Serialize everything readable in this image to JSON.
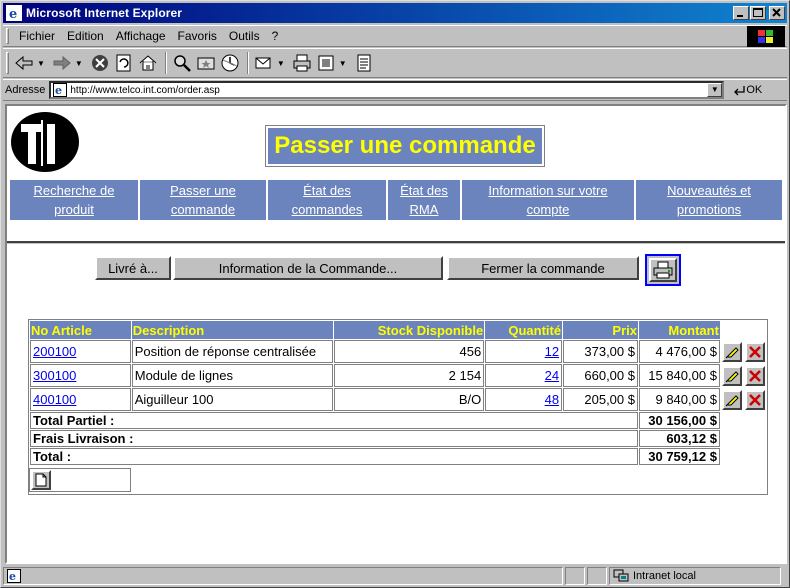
{
  "window": {
    "title": "Microsoft Internet Explorer"
  },
  "menu": [
    {
      "label": "Fichier"
    },
    {
      "label": "Edition"
    },
    {
      "label": "Affichage"
    },
    {
      "label": "Favoris"
    },
    {
      "label": "Outils"
    },
    {
      "label": "?"
    }
  ],
  "toolbar": {
    "icons": [
      "back-arrow-icon",
      "forward-arrow-icon",
      "stop-icon",
      "refresh-icon",
      "home-icon",
      "search-icon",
      "favorites-icon",
      "history-icon",
      "mail-icon",
      "print-icon",
      "edit-icon",
      "discuss-icon"
    ]
  },
  "address": {
    "label": "Adresse",
    "url": "http://www.telco.int.com/order.asp",
    "go_label": "OK"
  },
  "page": {
    "logo_text": "TI",
    "title": "Passer une commande",
    "nav": [
      {
        "line1": "Recherche de",
        "line2": "produit"
      },
      {
        "line1": "Passer une",
        "line2": "commande"
      },
      {
        "line1": "État des",
        "line2": "commandes"
      },
      {
        "line1": "État des",
        "line2": "RMA"
      },
      {
        "line1": "Information sur votre",
        "line2": "compte"
      },
      {
        "line1": "Nouveautés et",
        "line2": "promotions"
      }
    ],
    "buttons": {
      "deliver": "Livré à...",
      "info": "Information de la Commande...",
      "close": "Fermer la commande"
    },
    "table": {
      "headers": {
        "article": "No Article",
        "description": "Description",
        "stock": "Stock Disponible",
        "qty": "Quantité",
        "price": "Prix",
        "amount": "Montant"
      },
      "rows": [
        {
          "article": "200100",
          "description": "Position de réponse centralisée",
          "stock": "456",
          "qty": "12",
          "price": "373,00 $",
          "amount": "4 476,00 $"
        },
        {
          "article": "300100",
          "description": "Module de lignes",
          "stock": "2 154",
          "qty": "24",
          "price": "660,00 $",
          "amount": "15 840,00 $"
        },
        {
          "article": "400100",
          "description": "Aiguilleur 100",
          "stock": "B/O",
          "qty": "48",
          "price": "205,00 $",
          "amount": "9 840,00 $"
        }
      ],
      "totals": [
        {
          "label": "Total Partiel :",
          "value": "30 156,00 $"
        },
        {
          "label": "Frais Livraison :",
          "value": "603,12 $"
        },
        {
          "label": "Total :",
          "value": "30 759,12 $"
        }
      ]
    }
  },
  "status": {
    "zone": "Intranet local"
  }
}
